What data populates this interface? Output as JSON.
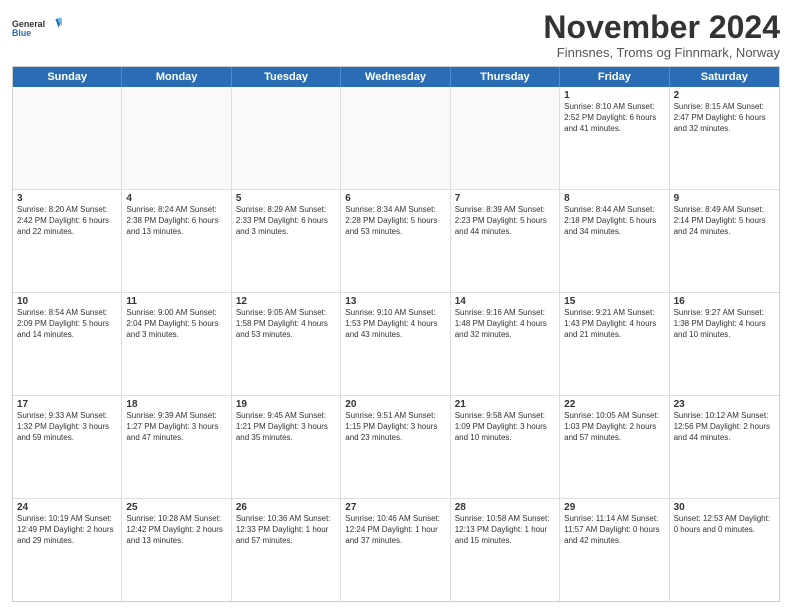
{
  "logo": {
    "general": "General",
    "blue": "Blue"
  },
  "title": "November 2024",
  "subtitle": "Finnsnes, Troms og Finnmark, Norway",
  "days": [
    "Sunday",
    "Monday",
    "Tuesday",
    "Wednesday",
    "Thursday",
    "Friday",
    "Saturday"
  ],
  "rows": [
    [
      {
        "day": "",
        "detail": ""
      },
      {
        "day": "",
        "detail": ""
      },
      {
        "day": "",
        "detail": ""
      },
      {
        "day": "",
        "detail": ""
      },
      {
        "day": "",
        "detail": ""
      },
      {
        "day": "1",
        "detail": "Sunrise: 8:10 AM\nSunset: 2:52 PM\nDaylight: 6 hours\nand 41 minutes."
      },
      {
        "day": "2",
        "detail": "Sunrise: 8:15 AM\nSunset: 2:47 PM\nDaylight: 6 hours\nand 32 minutes."
      }
    ],
    [
      {
        "day": "3",
        "detail": "Sunrise: 8:20 AM\nSunset: 2:42 PM\nDaylight: 6 hours\nand 22 minutes."
      },
      {
        "day": "4",
        "detail": "Sunrise: 8:24 AM\nSunset: 2:38 PM\nDaylight: 6 hours\nand 13 minutes."
      },
      {
        "day": "5",
        "detail": "Sunrise: 8:29 AM\nSunset: 2:33 PM\nDaylight: 6 hours\nand 3 minutes."
      },
      {
        "day": "6",
        "detail": "Sunrise: 8:34 AM\nSunset: 2:28 PM\nDaylight: 5 hours\nand 53 minutes."
      },
      {
        "day": "7",
        "detail": "Sunrise: 8:39 AM\nSunset: 2:23 PM\nDaylight: 5 hours\nand 44 minutes."
      },
      {
        "day": "8",
        "detail": "Sunrise: 8:44 AM\nSunset: 2:18 PM\nDaylight: 5 hours\nand 34 minutes."
      },
      {
        "day": "9",
        "detail": "Sunrise: 8:49 AM\nSunset: 2:14 PM\nDaylight: 5 hours\nand 24 minutes."
      }
    ],
    [
      {
        "day": "10",
        "detail": "Sunrise: 8:54 AM\nSunset: 2:09 PM\nDaylight: 5 hours\nand 14 minutes."
      },
      {
        "day": "11",
        "detail": "Sunrise: 9:00 AM\nSunset: 2:04 PM\nDaylight: 5 hours\nand 3 minutes."
      },
      {
        "day": "12",
        "detail": "Sunrise: 9:05 AM\nSunset: 1:58 PM\nDaylight: 4 hours\nand 53 minutes."
      },
      {
        "day": "13",
        "detail": "Sunrise: 9:10 AM\nSunset: 1:53 PM\nDaylight: 4 hours\nand 43 minutes."
      },
      {
        "day": "14",
        "detail": "Sunrise: 9:16 AM\nSunset: 1:48 PM\nDaylight: 4 hours\nand 32 minutes."
      },
      {
        "day": "15",
        "detail": "Sunrise: 9:21 AM\nSunset: 1:43 PM\nDaylight: 4 hours\nand 21 minutes."
      },
      {
        "day": "16",
        "detail": "Sunrise: 9:27 AM\nSunset: 1:38 PM\nDaylight: 4 hours\nand 10 minutes."
      }
    ],
    [
      {
        "day": "17",
        "detail": "Sunrise: 9:33 AM\nSunset: 1:32 PM\nDaylight: 3 hours\nand 59 minutes."
      },
      {
        "day": "18",
        "detail": "Sunrise: 9:39 AM\nSunset: 1:27 PM\nDaylight: 3 hours\nand 47 minutes."
      },
      {
        "day": "19",
        "detail": "Sunrise: 9:45 AM\nSunset: 1:21 PM\nDaylight: 3 hours\nand 35 minutes."
      },
      {
        "day": "20",
        "detail": "Sunrise: 9:51 AM\nSunset: 1:15 PM\nDaylight: 3 hours\nand 23 minutes."
      },
      {
        "day": "21",
        "detail": "Sunrise: 9:58 AM\nSunset: 1:09 PM\nDaylight: 3 hours\nand 10 minutes."
      },
      {
        "day": "22",
        "detail": "Sunrise: 10:05 AM\nSunset: 1:03 PM\nDaylight: 2 hours\nand 57 minutes."
      },
      {
        "day": "23",
        "detail": "Sunrise: 10:12 AM\nSunset: 12:56 PM\nDaylight: 2 hours\nand 44 minutes."
      }
    ],
    [
      {
        "day": "24",
        "detail": "Sunrise: 10:19 AM\nSunset: 12:49 PM\nDaylight: 2 hours\nand 29 minutes."
      },
      {
        "day": "25",
        "detail": "Sunrise: 10:28 AM\nSunset: 12:42 PM\nDaylight: 2 hours\nand 13 minutes."
      },
      {
        "day": "26",
        "detail": "Sunrise: 10:36 AM\nSunset: 12:33 PM\nDaylight: 1 hour and\n57 minutes."
      },
      {
        "day": "27",
        "detail": "Sunrise: 10:46 AM\nSunset: 12:24 PM\nDaylight: 1 hour and\n37 minutes."
      },
      {
        "day": "28",
        "detail": "Sunrise: 10:58 AM\nSunset: 12:13 PM\nDaylight: 1 hour and\n15 minutes."
      },
      {
        "day": "29",
        "detail": "Sunrise: 11:14 AM\nSunset: 11:57 AM\nDaylight: 0 hours\nand 42 minutes."
      },
      {
        "day": "30",
        "detail": "Sunset: 12:53 AM\nDaylight: 0 hours\nand 0 minutes."
      }
    ]
  ]
}
